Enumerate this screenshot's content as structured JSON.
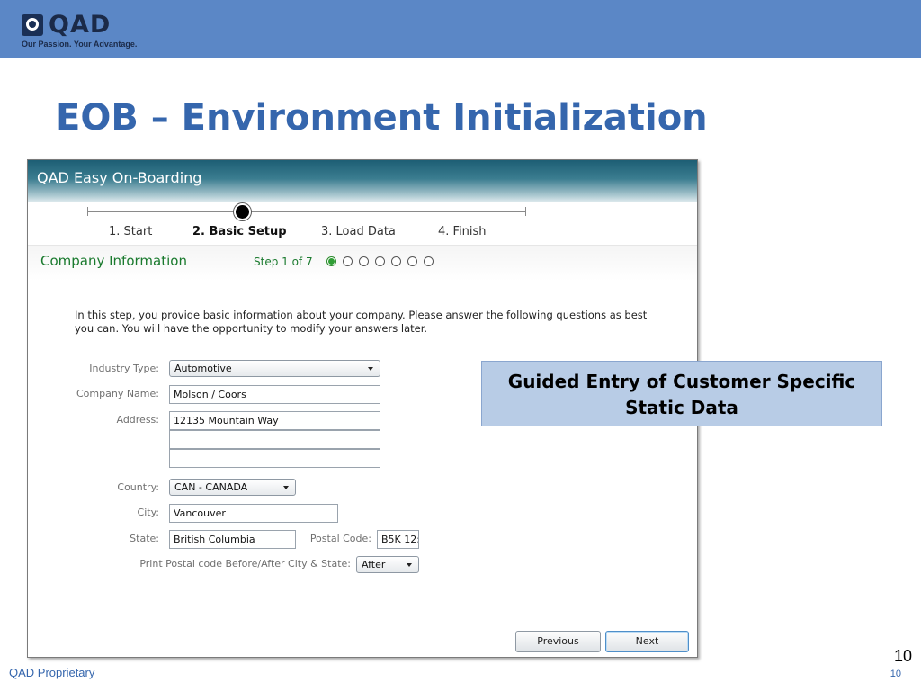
{
  "brand": {
    "logo_text": "QAD",
    "tagline": "Our Passion. Your Advantage."
  },
  "slide": {
    "title": "EOB – Environment Initialization",
    "callout": "Guided Entry of Customer Specific Static Data",
    "footer": "QAD Proprietary",
    "page_number": "10",
    "page_number_small": "10"
  },
  "window": {
    "title": "QAD Easy On-Boarding",
    "wizard_steps": [
      {
        "label": "1. Start",
        "active": false
      },
      {
        "label": "2. Basic Setup",
        "active": true
      },
      {
        "label": "3. Load Data",
        "active": false
      },
      {
        "label": "4. Finish",
        "active": false
      }
    ],
    "section": {
      "title": "Company Information",
      "step_counter": "Step 1 of 7",
      "current_substep": 1,
      "total_substeps": 7
    },
    "intro": "In this step, you provide basic information about your company. Please answer the following questions as best you can. You will have the opportunity to modify your answers later.",
    "form": {
      "industry_type": {
        "label": "Industry Type:",
        "value": "Automotive"
      },
      "company_name": {
        "label": "Company Name:",
        "value": "Molson / Coors"
      },
      "address": {
        "label": "Address:",
        "line1": "12135 Mountain Way",
        "line2": "",
        "line3": ""
      },
      "country": {
        "label": "Country:",
        "value": "CAN - CANADA"
      },
      "city": {
        "label": "City:",
        "value": "Vancouver"
      },
      "state": {
        "label": "State:",
        "value": "British Columbia"
      },
      "postal_code": {
        "label": "Postal Code:",
        "value": "B5K 12:"
      },
      "print_postal": {
        "label": "Print Postal code Before/After City & State:",
        "value": "After"
      }
    },
    "buttons": {
      "previous": "Previous",
      "next": "Next"
    }
  },
  "colors": {
    "banner": "#5b87c6",
    "title": "#3566ad",
    "section_green": "#1a7a2e",
    "callout_bg": "#b8cce6"
  }
}
